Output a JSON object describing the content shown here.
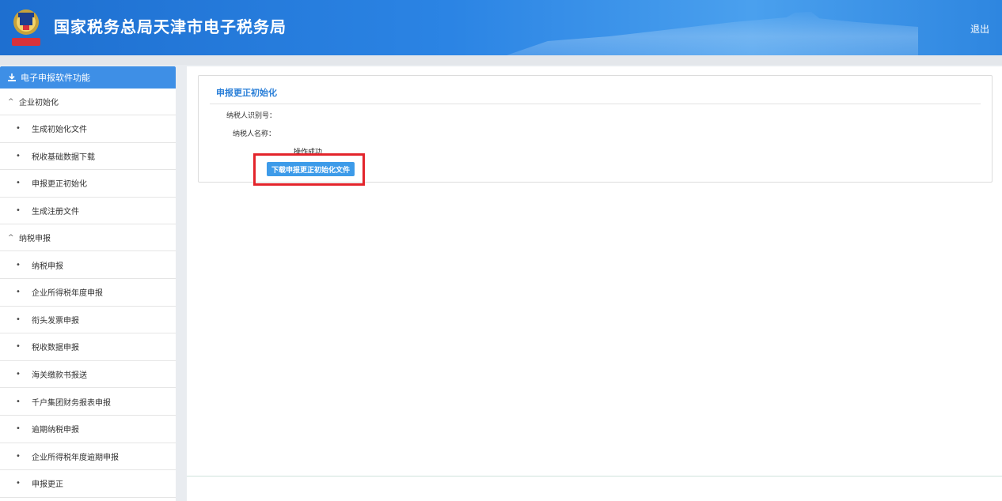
{
  "header": {
    "title": "国家税务总局天津市电子税务局",
    "logout_label": "退出"
  },
  "sidebar": {
    "header_label": "电子申报软件功能",
    "groups": [
      {
        "label": "企业初始化",
        "items": [
          "生成初始化文件",
          "税收基础数据下载",
          "申报更正初始化",
          "生成注册文件"
        ]
      },
      {
        "label": "纳税申报",
        "items": [
          "纳税申报",
          "企业所得税年度申报",
          "衔头发票申报",
          "税收数据申报",
          "海关缴款书报送",
          "千户集团财务报表申报",
          "逾期纳税申报",
          "企业所得税年度逾期申报",
          "申报更正"
        ]
      }
    ]
  },
  "panel": {
    "title": "申报更正初始化",
    "taxpayer_id_label": "纳税人识别号：",
    "taxpayer_name_label": "纳税人名称：",
    "status_text": "操作成功",
    "download_button_label": "下载申报更正初始化文件"
  },
  "colors": {
    "header_blue": "#2b84e4",
    "accent_blue": "#2a7fd8",
    "button_blue": "#3d9be9",
    "highlight_red": "#e3242b"
  }
}
